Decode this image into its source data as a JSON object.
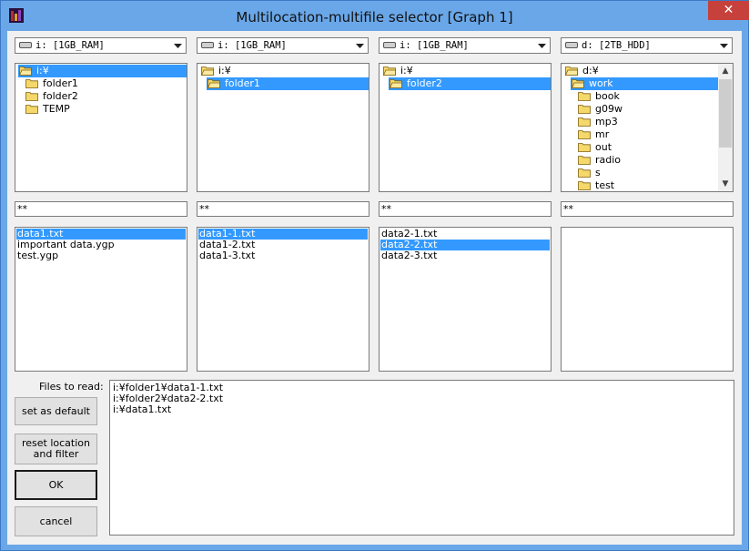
{
  "window": {
    "title": "Multilocation-multifile selector [Graph 1]",
    "close_glyph": "✕"
  },
  "columns": [
    {
      "drive": "i: [1GB_RAM]",
      "tree": [
        {
          "label": "i:¥",
          "level": 0,
          "open": true,
          "selected": true
        },
        {
          "label": "folder1",
          "level": 1,
          "open": false,
          "selected": false
        },
        {
          "label": "folder2",
          "level": 1,
          "open": false,
          "selected": false
        },
        {
          "label": "TEMP",
          "level": 1,
          "open": false,
          "selected": false
        }
      ],
      "filter": "**",
      "files": [
        {
          "name": "data1.txt",
          "selected": true
        },
        {
          "name": "important data.ygp",
          "selected": false
        },
        {
          "name": "test.ygp",
          "selected": false
        }
      ]
    },
    {
      "drive": "i: [1GB_RAM]",
      "tree": [
        {
          "label": "i:¥",
          "level": 0,
          "open": true,
          "selected": false
        },
        {
          "label": "folder1",
          "level": 1,
          "open": true,
          "selected": true
        }
      ],
      "filter": "**",
      "files": [
        {
          "name": "data1-1.txt",
          "selected": true
        },
        {
          "name": "data1-2.txt",
          "selected": false
        },
        {
          "name": "data1-3.txt",
          "selected": false
        }
      ]
    },
    {
      "drive": "i: [1GB_RAM]",
      "tree": [
        {
          "label": "i:¥",
          "level": 0,
          "open": true,
          "selected": false
        },
        {
          "label": "folder2",
          "level": 1,
          "open": true,
          "selected": true
        }
      ],
      "filter": "**",
      "files": [
        {
          "name": "data2-1.txt",
          "selected": false
        },
        {
          "name": "data2-2.txt",
          "selected": true
        },
        {
          "name": "data2-3.txt",
          "selected": false
        }
      ]
    },
    {
      "drive": "d: [2TB_HDD]",
      "tree": [
        {
          "label": "d:¥",
          "level": 0,
          "open": true,
          "selected": false
        },
        {
          "label": "work",
          "level": 1,
          "open": true,
          "selected": true
        },
        {
          "label": "book",
          "level": 2,
          "open": false,
          "selected": false
        },
        {
          "label": "g09w",
          "level": 2,
          "open": false,
          "selected": false
        },
        {
          "label": "mp3",
          "level": 2,
          "open": false,
          "selected": false
        },
        {
          "label": "mr",
          "level": 2,
          "open": false,
          "selected": false
        },
        {
          "label": "out",
          "level": 2,
          "open": false,
          "selected": false
        },
        {
          "label": "radio",
          "level": 2,
          "open": false,
          "selected": false
        },
        {
          "label": "s",
          "level": 2,
          "open": false,
          "selected": false
        },
        {
          "label": "test",
          "level": 2,
          "open": false,
          "selected": false
        }
      ],
      "filter": "**",
      "files": []
    }
  ],
  "files_to_read": {
    "label": "Files to read:",
    "lines": [
      "i:¥folder1¥data1-1.txt",
      "i:¥folder2¥data2-2.txt",
      "i:¥data1.txt"
    ]
  },
  "buttons": {
    "set_default": "set as default",
    "reset_line1": "reset location",
    "reset_line2": "and filter",
    "ok": "OK",
    "cancel": "cancel"
  },
  "colors": {
    "selection": "#3399ff",
    "title_bar": "#6aa7e8",
    "close_button": "#c7413c",
    "folder": "#f5d86a"
  }
}
